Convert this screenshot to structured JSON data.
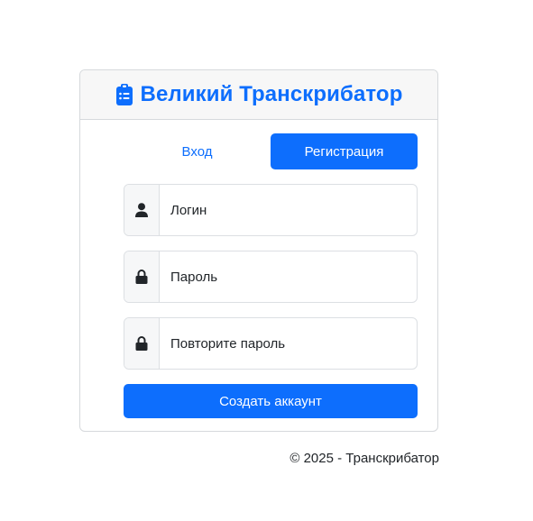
{
  "header": {
    "title": "Великий Транскрибатор",
    "icon": "clipboard-list-icon",
    "accent": "#0d6efd"
  },
  "tabs": [
    {
      "label": "Вход",
      "active": false
    },
    {
      "label": "Регистрация",
      "active": true
    }
  ],
  "form": {
    "login": {
      "placeholder": "Логин",
      "icon": "user-icon",
      "value": ""
    },
    "password": {
      "placeholder": "Пароль",
      "icon": "lock-icon",
      "value": ""
    },
    "repeat_password": {
      "placeholder": "Повторите пароль",
      "icon": "lock-icon",
      "value": ""
    },
    "submit_label": "Создать аккаунт"
  },
  "footer": {
    "text": "© 2025 - Транскрибатор"
  }
}
